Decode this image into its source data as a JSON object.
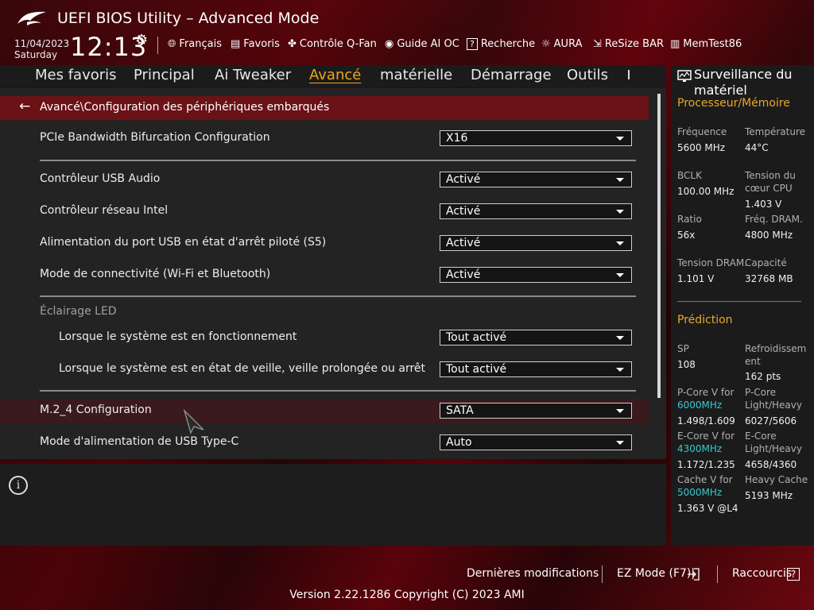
{
  "header": {
    "title": "UEFI BIOS Utility – Advanced Mode",
    "date": "11/04/2023",
    "day": "Saturday",
    "time": "12:13",
    "tools": [
      {
        "icon": "globe-icon",
        "label": "Français"
      },
      {
        "icon": "favorites-icon",
        "label": "Favoris"
      },
      {
        "icon": "fan-icon",
        "label": "Contrôle Q-Fan"
      },
      {
        "icon": "ai-icon",
        "label": "Guide AI OC"
      },
      {
        "icon": "search-icon",
        "label": "Recherche"
      },
      {
        "icon": "aura-icon",
        "label": "AURA"
      },
      {
        "icon": "resize-bar-icon",
        "label": "ReSize BAR"
      },
      {
        "icon": "memtest-icon",
        "label": "MemTest86"
      }
    ]
  },
  "nav": {
    "tabs": [
      "Mes favoris",
      "Principal",
      "Ai Tweaker",
      "Avancé",
      "matérielle",
      "Démarrage",
      "Outils"
    ],
    "active": "Avancé"
  },
  "breadcrumb": "Avancé\\Configuration des périphériques embarqués",
  "settings": [
    {
      "label": "PCIe Bandwidth Bifurcation Configuration",
      "value": "X16"
    },
    {
      "label": "Contrôleur USB Audio",
      "value": "Activé"
    },
    {
      "label": "Contrôleur réseau Intel",
      "value": "Activé"
    },
    {
      "label": "Alimentation du port USB en état d'arrêt piloté (S5)",
      "value": "Activé"
    },
    {
      "label": "Mode de connectivité (Wi-Fi et Bluetooth)",
      "value": "Activé"
    },
    {
      "label": "Lorsque le système est en fonctionnement",
      "value": "Tout activé"
    },
    {
      "label": "Lorsque le système est en état de veille, veille prolongée ou arrêt",
      "value": "Tout activé"
    },
    {
      "label": "M.2_4 Configuration",
      "value": "SATA"
    },
    {
      "label": "Mode d'alimentation de USB Type-C",
      "value": "Auto"
    }
  ],
  "led_section": "Éclairage LED",
  "hardware_monitor": {
    "title": "Surveillance du matériel",
    "cpu_section": "Processeur/Mémoire",
    "cpu": {
      "freq_k": "Fréquence",
      "freq_v": "5600 MHz",
      "temp_k": "Température",
      "temp_v": "44°C",
      "bclk_k": "BCLK",
      "bclk_v": "100.00 MHz",
      "vcore_k": "Tension du cœur CPU",
      "vcore_v": "1.403 V",
      "ratio_k": "Ratio",
      "ratio_v": "56x",
      "dramf_k": "Fréq. DRAM.",
      "dramf_v": "4800 MHz",
      "dramv_k": "Tension DRAM.",
      "dramv_v": "1.101 V",
      "cap_k": "Capacité",
      "cap_v": "32768 MB"
    },
    "pred_section": "Prédiction",
    "pred": {
      "sp_k": "SP",
      "sp_v": "108",
      "cool_k": "Refroidissement",
      "cool_v": "162 pts",
      "pcore_k": "P-Core V for",
      "pcore_f": "6000MHz",
      "pcore_v": "1.498/1.609",
      "plh_k": "P-Core Light/Heavy",
      "plh_v": "6027/5606",
      "ecore_k": "E-Core V for",
      "ecore_f": "4300MHz",
      "ecore_v": "1.172/1.235",
      "elh_k": "E-Core Light/Heavy",
      "elh_v": "4658/4360",
      "cache_k": "Cache V for",
      "cache_f": "5000MHz",
      "cache_v": "1.363 V @L4",
      "hcache_k": "Heavy Cache",
      "hcache_v": "5193 MHz"
    }
  },
  "footer": {
    "last_changes": "Dernières modifications",
    "ez_mode": "EZ Mode (F7)|",
    "shortcuts": "Raccourcis",
    "help": "?",
    "version": "Version 2.22.1286 Copyright (C) 2023 AMI"
  },
  "colors": {
    "accent": "#f0a61c",
    "highlight": "#36c9d2",
    "breadcrumb_bg": "#6a1216"
  }
}
